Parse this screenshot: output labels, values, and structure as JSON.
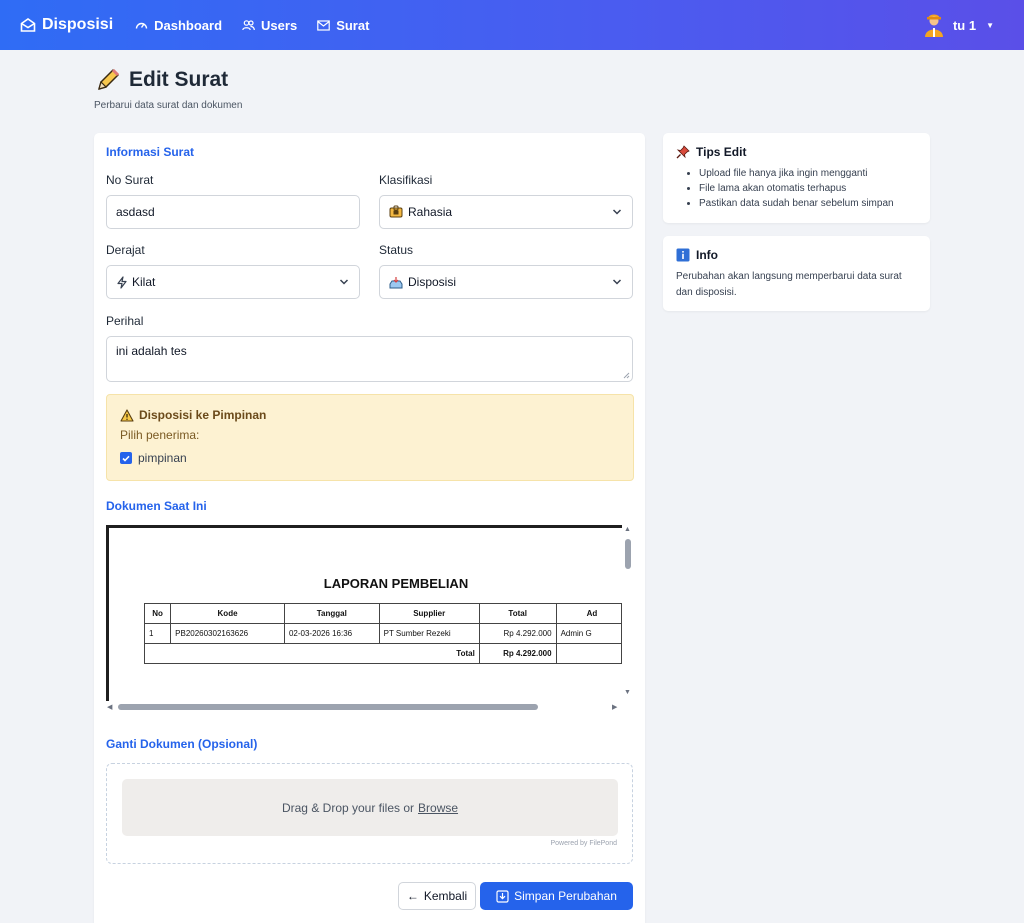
{
  "nav": {
    "brand": "Disposisi",
    "items": [
      {
        "label": "Dashboard",
        "icon": "gauge-icon"
      },
      {
        "label": "Users",
        "icon": "users-icon"
      },
      {
        "label": "Surat",
        "icon": "envelope-icon"
      }
    ],
    "user": "tu 1"
  },
  "header": {
    "title": "Edit Surat",
    "subtitle": "Perbarui data surat dan dokumen"
  },
  "form": {
    "section_title": "Informasi Surat",
    "no_surat": {
      "label": "No Surat",
      "value": "asdasd"
    },
    "klasifikasi": {
      "label": "Klasifikasi",
      "value": "Rahasia"
    },
    "derajat": {
      "label": "Derajat",
      "value": "Kilat"
    },
    "status": {
      "label": "Status",
      "value": "Disposisi"
    },
    "perihal": {
      "label": "Perihal",
      "value": "ini adalah tes"
    },
    "disposisi": {
      "title": "Disposisi ke Pimpinan",
      "subtitle": "Pilih penerima:",
      "recipients": [
        {
          "label": "pimpinan",
          "checked": true
        }
      ]
    }
  },
  "document": {
    "section_title": "Dokumen Saat Ini",
    "heading": "LAPORAN PEMBELIAN",
    "columns": [
      "No",
      "Kode",
      "Tanggal",
      "Supplier",
      "Total",
      "Ad"
    ],
    "rows": [
      [
        "1",
        "PB20260302163626",
        "02-03-2026 16:36",
        "PT Sumber Rezeki",
        "Rp 4.292.000",
        "Admin G"
      ]
    ],
    "total_label": "Total",
    "total_value": "Rp 4.292.000"
  },
  "upload": {
    "section_title": "Ganti Dokumen (Opsional)",
    "drop_text": "Drag & Drop your files or",
    "browse": "Browse",
    "powered_by": "Powered by FilePond"
  },
  "buttons": {
    "back": "Kembali",
    "save": "Simpan Perubahan"
  },
  "tips": {
    "title": "Tips Edit",
    "items": [
      "Upload file hanya jika ingin mengganti",
      "File lama akan otomatis terhapus",
      "Pastikan data sudah benar sebelum simpan"
    ]
  },
  "info": {
    "title": "Info",
    "text": "Perubahan akan langsung memperbarui data surat dan disposisi."
  },
  "colors": {
    "primary": "#2563eb",
    "warning_bg": "#fdf2d2",
    "page_bg": "#f1f3f7"
  }
}
